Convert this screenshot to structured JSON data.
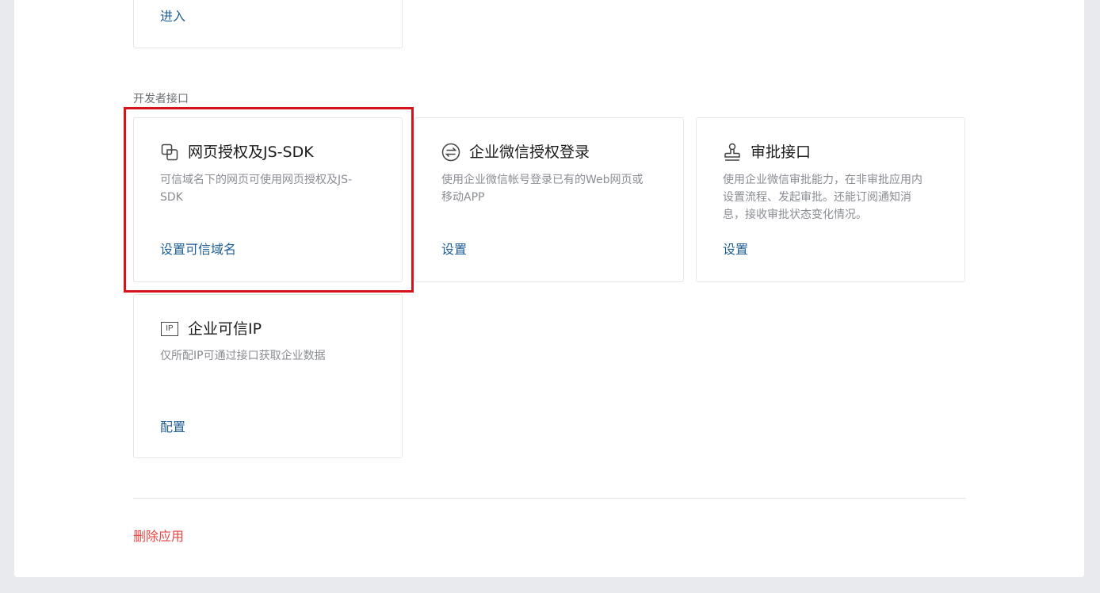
{
  "top_card": {
    "link": "进入"
  },
  "developer_section": {
    "label": "开发者接口",
    "cards": [
      {
        "icon": "copy-icon",
        "title": "网页授权及JS-SDK",
        "desc_line1": "可信域名下的网页可使用网页授权及JS-",
        "desc_line2": "SDK",
        "link": "设置可信域名"
      },
      {
        "icon": "swap-circle-icon",
        "title": "企业微信授权登录",
        "desc_line1": "使用企业微信帐号登录已有的Web网页或",
        "desc_line2": "移动APP",
        "link": "设置"
      },
      {
        "icon": "stamp-icon",
        "title": "审批接口",
        "desc_line1": "使用企业微信审批能力，在非审批应用内",
        "desc_line2": "设置流程、发起审批。还能订阅通知消",
        "desc_line3": "息，接收审批状态变化情况。",
        "link": "设置"
      },
      {
        "icon": "ip-icon",
        "icon_text": "IP",
        "title": "企业可信IP",
        "desc_line1": "仅所配IP可通过接口获取企业数据",
        "link": "配置"
      }
    ]
  },
  "footer": {
    "delete_label": "删除应用"
  },
  "colors": {
    "link": "#1e5d94",
    "danger": "#e64545",
    "highlight_border": "#d6141c",
    "page_bg": "#e9eaed"
  }
}
